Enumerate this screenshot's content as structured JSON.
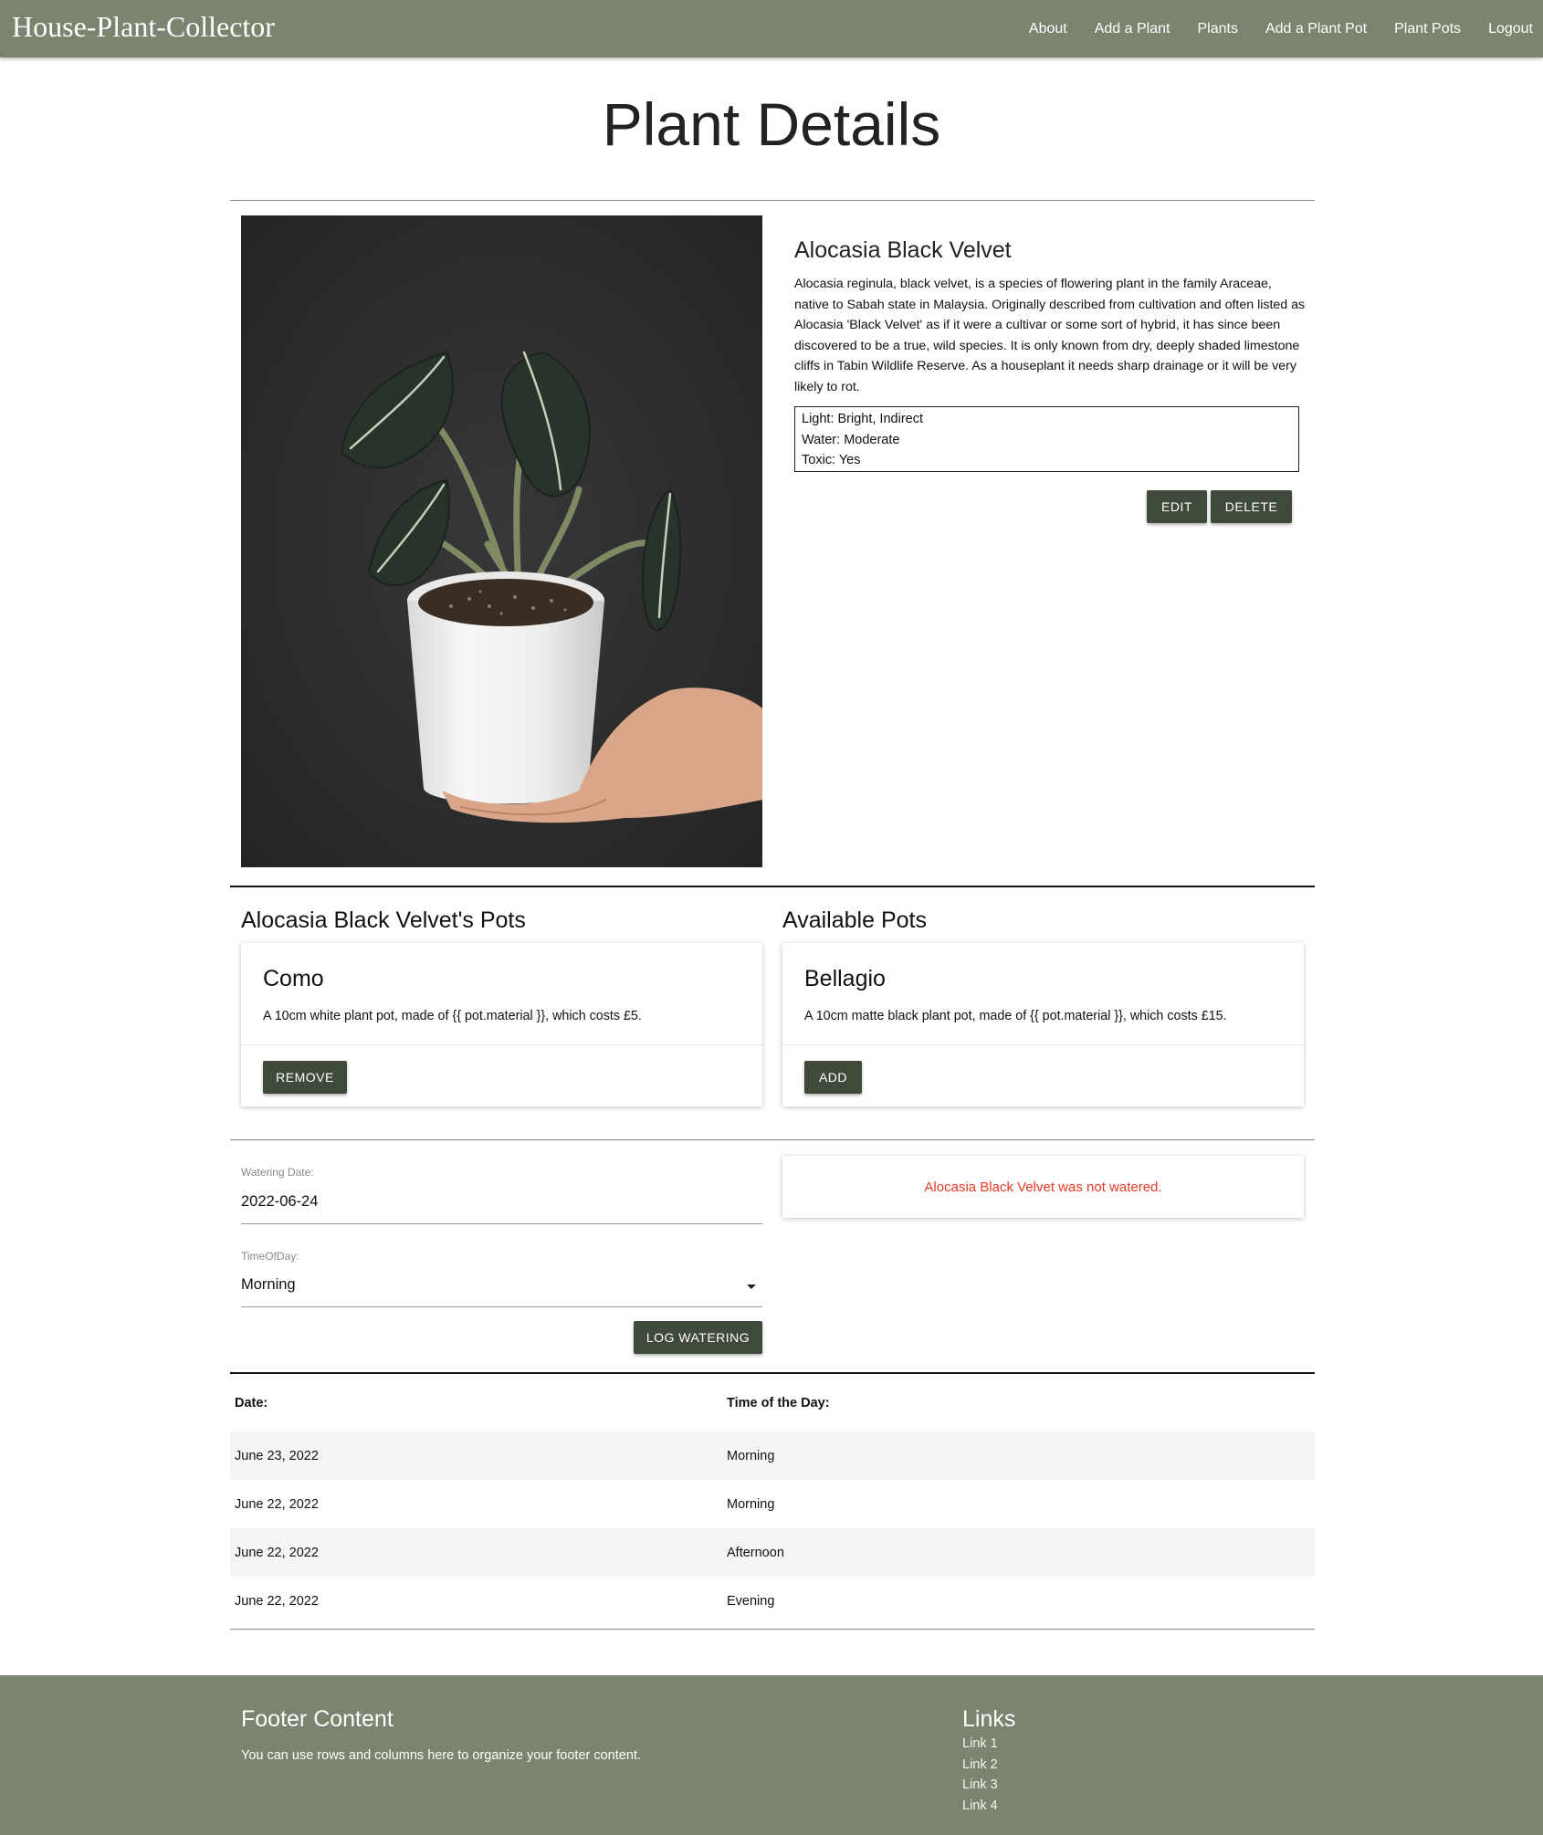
{
  "navbar": {
    "brand": "House-Plant-Collector",
    "links": [
      "About",
      "Add a Plant",
      "Plants",
      "Add a Plant Pot",
      "Plant Pots",
      "Logout"
    ]
  },
  "page_title": "Plant Details",
  "plant": {
    "name": "Alocasia Black Velvet",
    "description": "Alocasia reginula, black velvet, is a species of flowering plant in the family Araceae, native to Sabah state in Malaysia. Originally described from cultivation and often listed as Alocasia 'Black Velvet' as if it were a cultivar or some sort of hybrid, it has since been discovered to be a true, wild species. It is only known from dry, deeply shaded limestone cliffs in Tabin Wildlife Reserve. As a houseplant it needs sharp drainage or it will be very likely to rot.",
    "care": [
      "Light: Bright, Indirect",
      "Water: Moderate",
      "Toxic: Yes"
    ],
    "edit_label": "EDIT",
    "delete_label": "DELETE"
  },
  "pots": {
    "assigned_heading": "Alocasia Black Velvet's Pots",
    "available_heading": "Available Pots",
    "assigned": [
      {
        "name": "Como",
        "description": "A 10cm white plant pot, made of {{ pot.material }}, which costs £5.",
        "action": "REMOVE"
      }
    ],
    "available": [
      {
        "name": "Bellagio",
        "description": "A 10cm matte black plant pot, made of {{ pot.material }}, which costs £15.",
        "action": "ADD"
      }
    ]
  },
  "watering_form": {
    "date_label": "Watering Date:",
    "date_value": "2022-06-24",
    "time_label": "TimeOfDay:",
    "time_value": "Morning",
    "submit_label": "LOG WATERING",
    "status_message": "Alocasia Black Velvet was not watered."
  },
  "watering_log": {
    "headers": [
      "Date:",
      "Time of the Day:"
    ],
    "rows": [
      [
        "June 23, 2022",
        "Morning"
      ],
      [
        "June 22, 2022",
        "Morning"
      ],
      [
        "June 22, 2022",
        "Afternoon"
      ],
      [
        "June 22, 2022",
        "Evening"
      ]
    ]
  },
  "footer": {
    "heading": "Footer Content",
    "text": "You can use rows and columns here to organize your footer content.",
    "links_heading": "Links",
    "links": [
      "Link 1",
      "Link 2",
      "Link 3",
      "Link 4"
    ]
  },
  "colors": {
    "nav_bg": "#7b846e",
    "button_bg": "#3f4a3a",
    "status_red": "#e53b23"
  }
}
